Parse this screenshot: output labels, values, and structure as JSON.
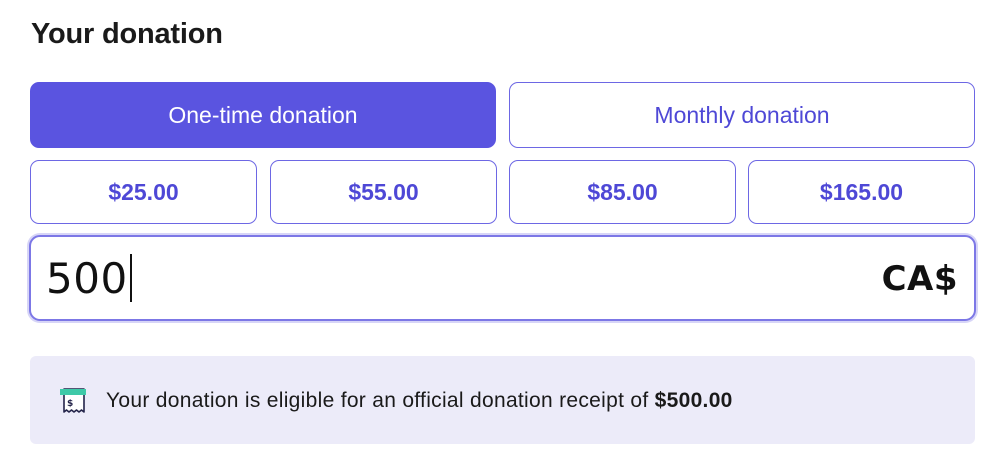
{
  "section": {
    "title": "Your donation"
  },
  "frequency": {
    "selected": "one-time",
    "one_time_label": "One-time donation",
    "monthly_label": "Monthly donation"
  },
  "amounts": [
    {
      "label": "$25.00"
    },
    {
      "label": "$55.00"
    },
    {
      "label": "$85.00"
    },
    {
      "label": "$165.00"
    }
  ],
  "custom_amount": {
    "value": "500",
    "currency": "CA$"
  },
  "notice": {
    "icon": "receipt-icon",
    "text_prefix": "Your donation is eligible for an official donation receipt of",
    "amount": "$500.00"
  },
  "colors": {
    "accent": "#5a54e0",
    "accent_text": "#4e48d6",
    "notice_background": "#ecebf9"
  }
}
